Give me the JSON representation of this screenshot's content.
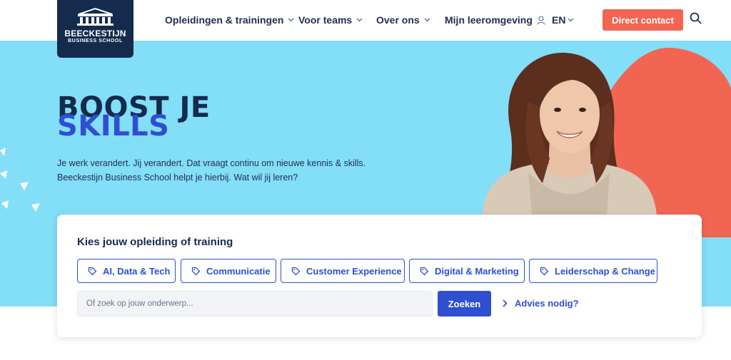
{
  "header": {
    "logo": {
      "line1": "BEECKESTIJN",
      "line2": "BUSINESS SCHOOL"
    },
    "nav": [
      {
        "label": "Opleidingen & trainingen",
        "icon": "chevron-down-icon"
      },
      {
        "label": "Voor teams",
        "icon": "chevron-down-icon"
      },
      {
        "label": "Over ons",
        "icon": "chevron-down-icon"
      },
      {
        "label": "Mijn leeromgeving",
        "icon": "user-icon"
      },
      {
        "label": "EN",
        "icon": "chevron-down-icon"
      }
    ],
    "cta_label": "Direct contact",
    "search_icon": "search-icon"
  },
  "hero": {
    "title_line1": "BOOST JE",
    "title_line2": "SKILLS",
    "text_line1": "Je werk verandert. Jij verandert. Dat vraagt continu om nieuwe kennis & skills.",
    "text_line2": "Beeckestijn Business School helpt je hierbij. Wat wil jij leren?"
  },
  "search_card": {
    "title": "Kies jouw opleiding of training",
    "categories": [
      {
        "label": "AI, Data & Tech",
        "icon": "tag-icon"
      },
      {
        "label": "Communicatie",
        "icon": "tag-icon"
      },
      {
        "label": "Customer Experience",
        "icon": "tag-icon"
      },
      {
        "label": "Digital & Marketing",
        "icon": "tag-icon"
      },
      {
        "label": "Leiderschap & Change",
        "icon": "tag-icon"
      }
    ],
    "search_placeholder": "Of zoek op jouw onderwerp...",
    "search_value": "",
    "search_button": "Zoeken",
    "advice_link": "Advies nodig?"
  },
  "colors": {
    "navy": "#142b4d",
    "hero_bg": "#83def7",
    "accent_coral": "#f26553",
    "accent_blue": "#2f4fd0"
  }
}
